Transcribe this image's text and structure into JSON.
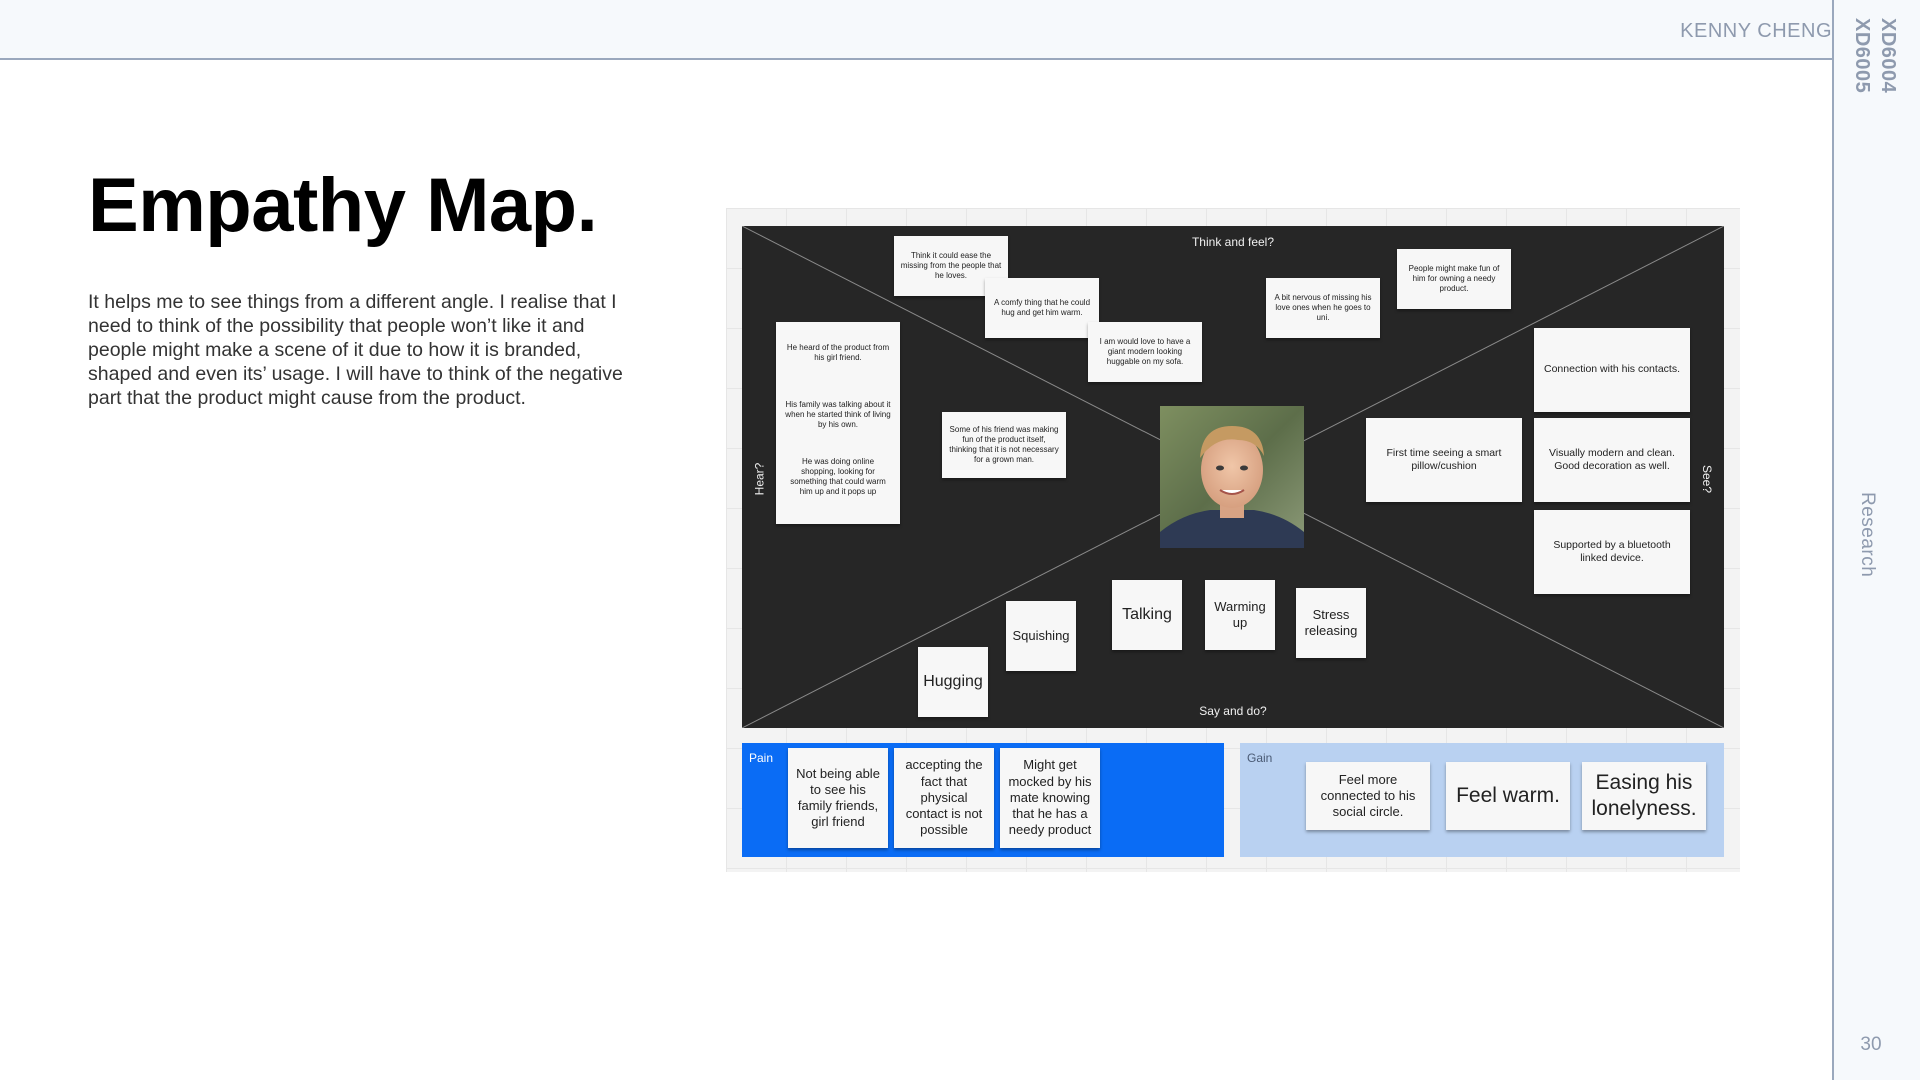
{
  "header": {
    "author": "KENNY CHENG",
    "course_codes": [
      "XD6004",
      "XD6005"
    ]
  },
  "sidebar": {
    "section": "Research",
    "page_number": "30"
  },
  "slide": {
    "title": "Empathy Map.",
    "description": "It helps me to see things from a different angle. I realise that I need to think of the possibility that people won’t like it and people might make a scene of it due to how it is branded, shaped and even its’ usage. I will have to think of the negative part that the product might cause from the product."
  },
  "map": {
    "questions": {
      "think": "Think and feel?",
      "say": "Say and do?",
      "hear": "Hear?",
      "see": "See?"
    },
    "think_notes": [
      "Think it could ease the missing from the people that he loves.",
      "A comfy thing that he could hug and get him warm.",
      "I am would love to have a giant modern looking huggable on my sofa.",
      "A bit nervous of missing his love ones when he goes to uni.",
      "People might make fun of him for owning a needy product."
    ],
    "hear_notes": [
      "He heard of the product from his girl friend.",
      "His family was talking about it when he started think of living by his own.",
      "He was doing online shopping, looking for something that could warm him up and it pops up",
      "Some of his friend was making fun of the product itself, thinking that it is not necessary for a grown man."
    ],
    "see_notes": [
      "Connection with his contacts.",
      "First time seeing a smart pillow/cushion",
      "Visually modern and clean. Good decoration as well.",
      "Supported by a bluetooth linked device."
    ],
    "say_notes": [
      "Hugging",
      "Squishing",
      "Talking",
      "Warming up",
      "Stress releasing"
    ]
  },
  "pain": {
    "label": "Pain",
    "notes": [
      "Not being able to see his family friends, girl friend",
      "accepting the fact that physical contact is not possible",
      "Might get mocked by his mate knowing that he has a needy product"
    ]
  },
  "gain": {
    "label": "Gain",
    "notes": [
      "Feel more connected to his social circle.",
      "Feel warm.",
      "Easing his lonelyness."
    ]
  },
  "colors": {
    "pain_zone": "#0a6cf5",
    "gain_zone": "#b9d1f1",
    "map_bg": "#262626",
    "frame_text": "#8e9aae"
  }
}
